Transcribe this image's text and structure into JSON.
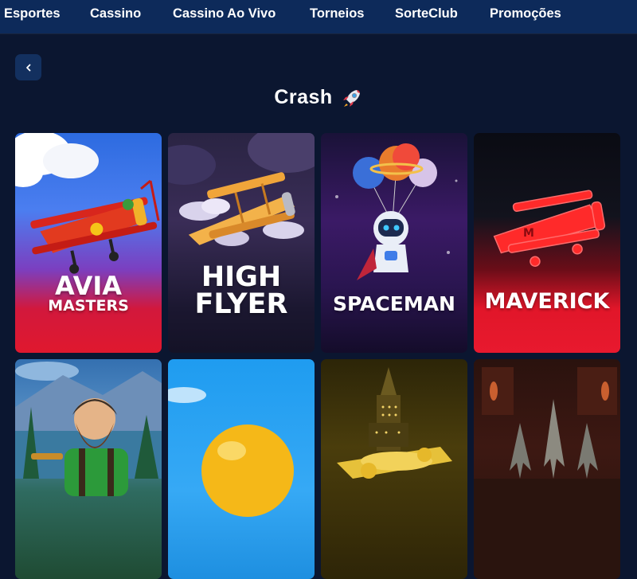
{
  "nav": {
    "items": [
      "Esportes",
      "Cassino",
      "Cassino Ao Vivo",
      "Torneios",
      "SorteClub",
      "Promoções"
    ],
    "background": "#0d2a5a"
  },
  "back_button": {
    "icon": "chevron-left-icon"
  },
  "page": {
    "title": "Crash",
    "title_icon": "rocket-icon",
    "background": "#0b1630"
  },
  "games": [
    {
      "name_line1": "AVIA",
      "name_line2": "MASTERS",
      "theme": "red-biplane"
    },
    {
      "name_line1": "HIGH",
      "name_line2": "FLYER",
      "theme": "gold-biplane"
    },
    {
      "name_line1": "SPACEMAN",
      "name_line2": "",
      "theme": "astronaut"
    },
    {
      "name_line1": "MAVERICK",
      "name_line2": "",
      "theme": "neon-biplane"
    },
    {
      "name_line1": "",
      "name_line2": "",
      "theme": "lumberjack"
    },
    {
      "name_line1": "",
      "name_line2": "",
      "theme": "balloon"
    },
    {
      "name_line1": "",
      "name_line2": "",
      "theme": "gold-plane"
    },
    {
      "name_line1": "",
      "name_line2": "",
      "theme": "dark-jets"
    }
  ]
}
